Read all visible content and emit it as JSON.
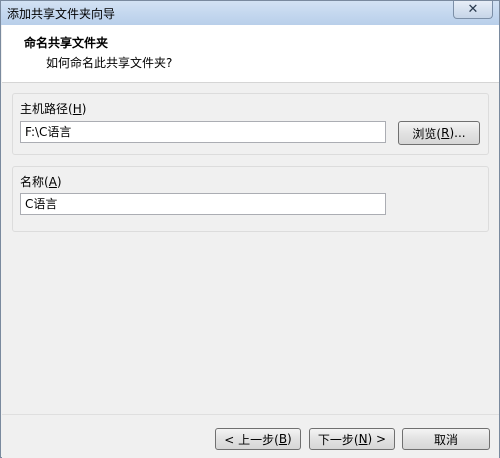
{
  "window": {
    "title": "添加共享文件夹向导",
    "close_symbol": "✕"
  },
  "header": {
    "title": "命名共享文件夹",
    "subtitle": "如何命名此共享文件夹?"
  },
  "host_path": {
    "label": "主机路径(",
    "label_key": "H",
    "label_end": ")",
    "value": "F:\\C语言",
    "browse_label": "浏览(",
    "browse_key": "R",
    "browse_end": ")..."
  },
  "share_name": {
    "label": "名称(",
    "label_key": "A",
    "label_end": ")",
    "value": "C语言"
  },
  "footer": {
    "back_label": "< 上一步(",
    "back_key": "B",
    "back_end": ")",
    "next_label": "下一步(",
    "next_key": "N",
    "next_end": ") >",
    "cancel_label": "取消"
  }
}
